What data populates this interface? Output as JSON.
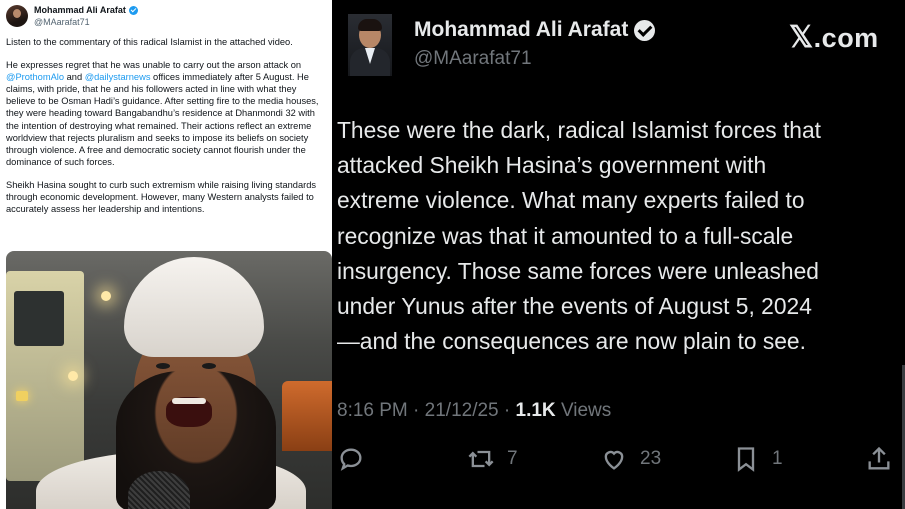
{
  "left_tweet": {
    "author_name": "Mohammad Ali Arafat",
    "author_handle": "@MAarafat71",
    "para1": "Listen to the commentary of this radical Islamist in the attached video.",
    "para2_before": "He expresses regret that he was unable to carry out the arson attack on ",
    "mention1": "@ProthomAlo",
    "para2_and": " and ",
    "mention2": "@dailystarnews",
    "para2_after": " offices immediately after 5 August. He claims, with pride, that he and his followers acted in line with what they believe to be Osman Hadi’s guidance. After setting fire to the media houses, they were heading toward Bangabandhu’s residence at Dhanmondi 32 with the intention of destroying what remained. Their actions reflect an extreme worldview that rejects pluralism and seeks to impose its beliefs on society through violence. A free and democratic society cannot flourish under the dominance of such forces.",
    "para3": "Sheikh Hasina sought to curb such extremism while raising living standards through economic development. However, many Western analysts failed to accurately assess her leadership and intentions."
  },
  "right_tweet": {
    "author_name": "Mohammad Ali Arafat",
    "author_handle": "@MAarafat71",
    "brand": ".com",
    "brand_mark": "𝕏",
    "text_lines": [
      "These were the dark, radical Islamist forces that",
      "attacked Sheikh Hasina’s government with",
      "extreme violence. What many experts failed to",
      "recognize was that it amounted to a full-scale",
      "insurgency. Those same forces were unleashed",
      "under Yunus after the events of August 5, 2024",
      "—and the consequences are now plain to see."
    ],
    "time": "8:16 PM",
    "date": "21/12/25",
    "views_count": "1.1K",
    "views_label": "Views",
    "separator": "·",
    "retweets": "7",
    "likes": "23",
    "bookmarks": "1"
  },
  "colors": {
    "link_blue": "#1d9bf0",
    "dark_bg": "#000000",
    "dark_text": "#e7e9ea",
    "dark_muted": "#71767b"
  },
  "icons": [
    "verified-badge-icon",
    "reply-icon",
    "retweet-icon",
    "like-icon",
    "bookmark-icon",
    "share-icon"
  ]
}
